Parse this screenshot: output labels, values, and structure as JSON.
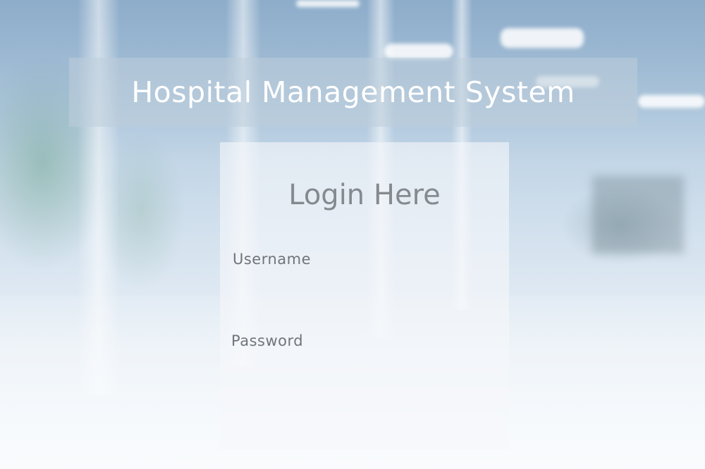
{
  "page": {
    "title": "Hospital Management System"
  },
  "login": {
    "heading": "Login Here",
    "username_label": "Username",
    "username_value": "",
    "password_label": "Password",
    "password_value": ""
  },
  "colors": {
    "title_text": "#ffffff",
    "heading_text": "#858a8f",
    "label_text": "#6f757b",
    "background_tint": "#b9cfe2"
  }
}
